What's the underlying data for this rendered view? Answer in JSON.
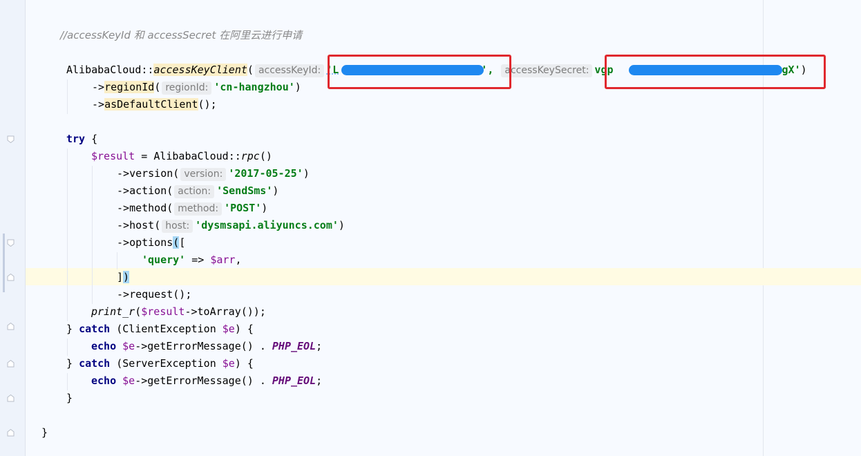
{
  "editor": {
    "comment": "//accessKeyId 和 accessSecret 在阿里云进行申请",
    "client": {
      "class_name": "AlibabaCloud",
      "method": "accessKeyClient",
      "hint_key_id": "accessKeyId:",
      "key_id_start": "'L",
      "key_id_end": "',",
      "hint_key_secret": "accessKeySecret:",
      "secret_start": "vgp",
      "secret_end": "gX'",
      "close_paren": ")"
    },
    "region": {
      "method": "regionId",
      "hint": "regionId:",
      "value": "'cn-hangzhou'"
    },
    "default_client": "asDefaultClient",
    "try_kw": "try",
    "result_var": "$result",
    "rpc_class": "AlibabaCloud",
    "rpc_method": "rpc",
    "version": {
      "method": "version",
      "hint": "version:",
      "value": "'2017-05-25'"
    },
    "action": {
      "method": "action",
      "hint": "action:",
      "value": "'SendSms'"
    },
    "http_method": {
      "method": "method",
      "hint": "method:",
      "value": "'POST'"
    },
    "host": {
      "method": "host",
      "hint": "host:",
      "value": "'dysmsapi.aliyuncs.com'"
    },
    "options_method": "options",
    "query_key": "'query'",
    "arr_var": "$arr",
    "request_method": "request",
    "print_fn": "print_r",
    "to_array": "toArray",
    "catch_kw": "catch",
    "client_exception": "ClientException",
    "server_exception": "ServerException",
    "e_var": "$e",
    "echo_kw": "echo",
    "get_error": "getErrorMessage",
    "php_eol": "PHP_EOL"
  },
  "colors": {
    "background": "#f7faff",
    "keyword": "#000080",
    "string": "#067d17",
    "variable": "#871094",
    "redaction_box": "#e0282e",
    "redaction_blur": "#1e88f0"
  }
}
